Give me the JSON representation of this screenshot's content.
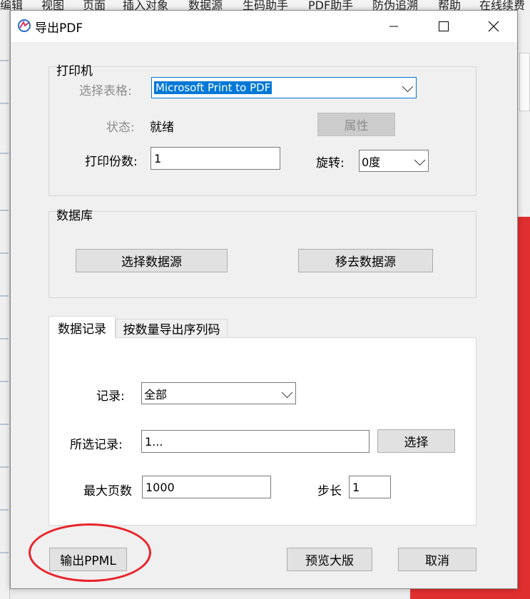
{
  "background_menu": [
    "编辑",
    "视图",
    "页面",
    "插入对象",
    "数据源",
    "生码助手",
    "PDF助手",
    "防伪追溯",
    "帮助",
    "在线续费"
  ],
  "dialog": {
    "title": "导出PDF",
    "icons": {
      "app": "app-logo-icon",
      "minimize": "minimize-icon",
      "maximize": "maximize-icon",
      "close": "close-icon"
    }
  },
  "printer": {
    "group_title": "打印机",
    "select_label": "选择表格:",
    "selected_printer": "Microsoft Print to PDF",
    "status_label": "状态:",
    "status_value": "就绪",
    "properties_button": "属性",
    "copies_label": "打印份数:",
    "copies_value": "1",
    "rotate_label": "旋转:",
    "rotate_value": "0度"
  },
  "database": {
    "group_title": "数据库",
    "select_source_button": "选择数据源",
    "remove_source_button": "移去数据源"
  },
  "tabs": [
    {
      "label": "数据记录",
      "active": true
    },
    {
      "label": "按数量导出序列码",
      "active": false
    }
  ],
  "records": {
    "record_label": "记录:",
    "record_value": "全部",
    "selected_label": "所选记录:",
    "selected_value": "1...",
    "select_button": "选择",
    "max_pages_label": "最大页数",
    "max_pages_value": "1000",
    "step_label": "步长",
    "step_value": "1"
  },
  "footer": {
    "export_button": "输出PPML",
    "preview_button": "预览大版",
    "cancel_button": "取消"
  },
  "colors": {
    "accent": "#0078d7",
    "annotation": "#e8232a",
    "background_red": "#e02f2f"
  }
}
